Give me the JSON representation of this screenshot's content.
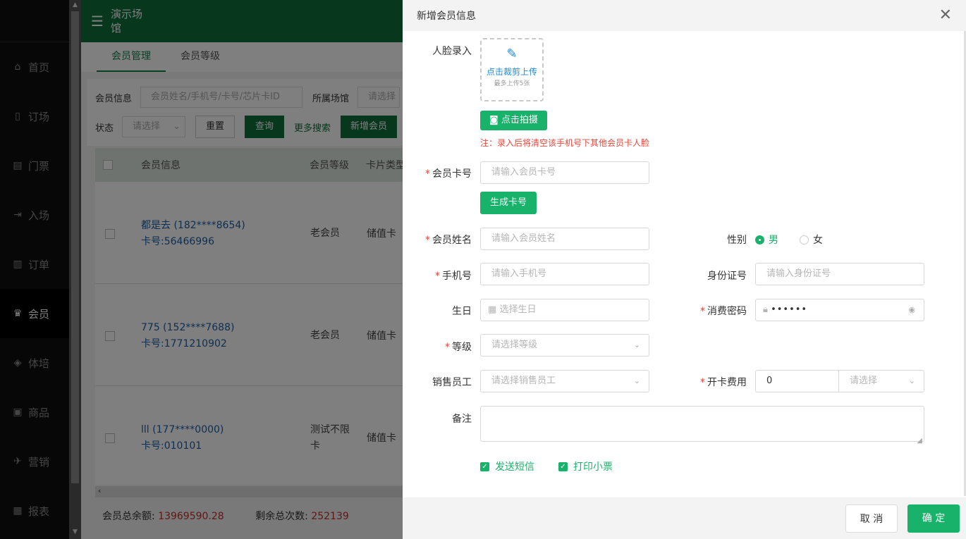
{
  "sidebar": {
    "items": [
      {
        "label": "首页",
        "icon": "home-icon",
        "glyph": "⌂"
      },
      {
        "label": "订场",
        "icon": "booking-icon",
        "glyph": "▯"
      },
      {
        "label": "门票",
        "icon": "ticket-icon",
        "glyph": "▤"
      },
      {
        "label": "入场",
        "icon": "entry-icon",
        "glyph": "⇥"
      },
      {
        "label": "订单",
        "icon": "order-icon",
        "glyph": "▥"
      },
      {
        "label": "会员",
        "icon": "member-icon",
        "glyph": "♛"
      },
      {
        "label": "体培",
        "icon": "training-icon",
        "glyph": "◈"
      },
      {
        "label": "商品",
        "icon": "goods-icon",
        "glyph": "▣"
      },
      {
        "label": "营销",
        "icon": "marketing-icon",
        "glyph": "✈"
      },
      {
        "label": "报表",
        "icon": "report-icon",
        "glyph": "▦"
      }
    ]
  },
  "header": {
    "venue": "演示场馆",
    "menu_icon": "☰"
  },
  "tabs": [
    "会员管理",
    "会员等级"
  ],
  "filter": {
    "member_info_label": "会员信息",
    "member_info_placeholder": "会员姓名/手机号/卡号/芯片卡ID",
    "venue_label": "所属场馆",
    "venue_placeholder": "请选择",
    "status_label": "状态",
    "status_placeholder": "请选择",
    "reset": "重置",
    "query": "查询",
    "more_search": "更多搜索",
    "add_member": "新增会员"
  },
  "table": {
    "headers": [
      "会员信息",
      "会员等级",
      "卡片类型"
    ],
    "rows": [
      {
        "name": "都是去 (182****8654)",
        "card": "卡号:56466996",
        "level": "老会员",
        "type": "储值卡"
      },
      {
        "name": "775 (152****7688)",
        "card": "卡号:1771210902",
        "level": "老会员",
        "type": "储值卡"
      },
      {
        "name": "lll (177****0000)",
        "card": "卡号:010101",
        "level": "测试不限卡",
        "type": "储值卡"
      }
    ]
  },
  "summary": {
    "balance_label": "会员总余额:",
    "balance_value": "13969590.28",
    "times_label": "剩余总次数:",
    "times_value": "252139"
  },
  "drawer": {
    "title": "新增会员信息",
    "face_label": "人脸录入",
    "upload_main": "点击裁剪上传",
    "upload_sub": "最多上传5张",
    "capture_button": "点击拍摄",
    "note": "注：录入后将清空该手机号下其他会员卡人脸",
    "card_no_label": "会员卡号",
    "card_no_placeholder": "请输入会员卡号",
    "gen_card_button": "生成卡号",
    "name_label": "会员姓名",
    "name_placeholder": "请输入会员姓名",
    "gender_label": "性别",
    "gender_male": "男",
    "gender_female": "女",
    "phone_label": "手机号",
    "phone_placeholder": "请输入手机号",
    "idcard_label": "身份证号",
    "idcard_placeholder": "请输入身份证号",
    "birthday_label": "生日",
    "birthday_placeholder": "选择生日",
    "password_label": "消费密码",
    "password_value": "••••••",
    "level_label": "等级",
    "level_placeholder": "请选择等级",
    "sales_label": "销售员工",
    "sales_placeholder": "请选择销售员工",
    "fee_label": "开卡费用",
    "fee_value": "0",
    "fee_unit_placeholder": "请选择",
    "remark_label": "备注",
    "sms_label": "发送短信",
    "print_label": "打印小票",
    "cancel": "取 消",
    "confirm": "确 定"
  }
}
